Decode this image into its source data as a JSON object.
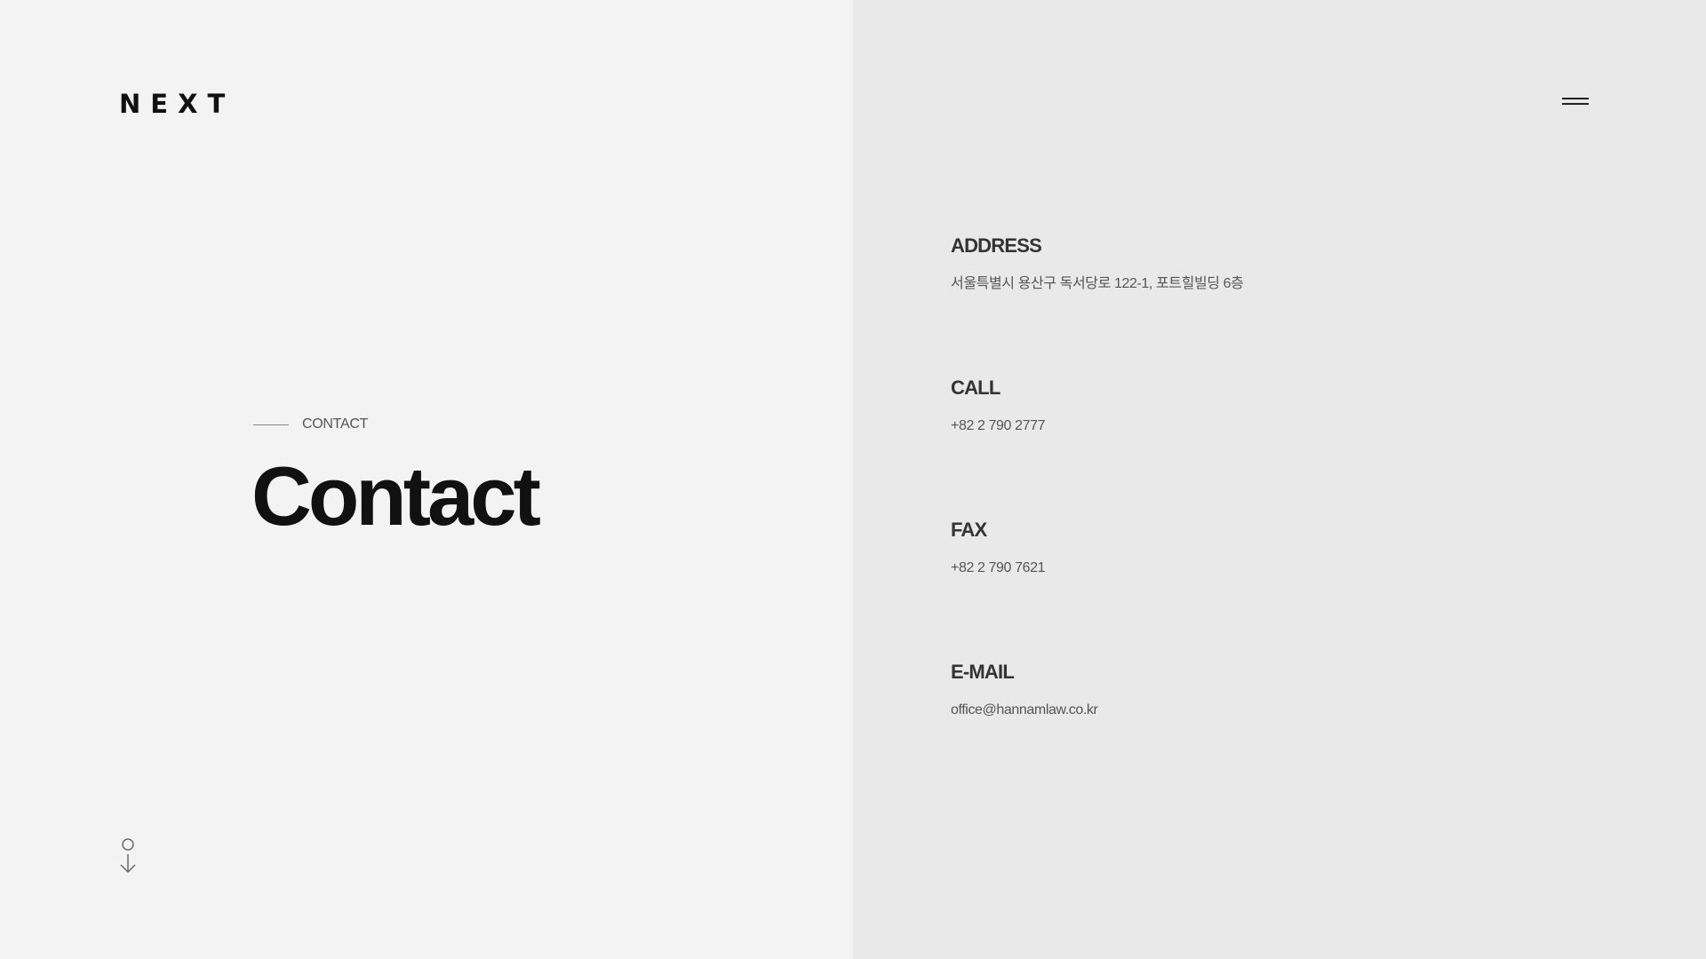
{
  "header": {
    "logo_text": "NEXT",
    "menu_icon": "hamburger-icon"
  },
  "hero": {
    "eyebrow": "CONTACT",
    "title": "Contact"
  },
  "scroll_indicator": {
    "icon": "scroll-down-arrow-icon"
  },
  "contact": {
    "items": [
      {
        "label": "ADDRESS",
        "value": "서울특별시 용산구 독서당로 122-1, 포트힐빌딩 6층"
      },
      {
        "label": "CALL",
        "value": "+82 2 790 2777"
      },
      {
        "label": "FAX",
        "value": "+82 2 790 7621"
      },
      {
        "label": "E-MAIL",
        "value": "office@hannamlaw.co.kr"
      }
    ]
  },
  "colors": {
    "left_background": "#f3f3f3",
    "right_background": "#e9e9e9",
    "title_text": "#111111",
    "label_text": "#333333",
    "body_text": "#555555"
  }
}
